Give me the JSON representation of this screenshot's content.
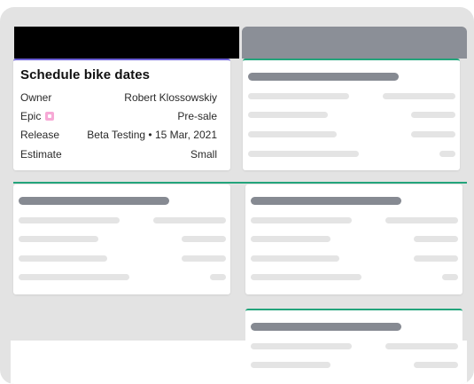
{
  "detail_card": {
    "title": "Schedule bike dates",
    "fields": [
      {
        "label": "Owner",
        "value": "Robert Klossowskiy"
      },
      {
        "label": "Epic",
        "value": "Pre-sale",
        "icon": "epic-badge-icon",
        "icon_color": "#f7a9d6"
      },
      {
        "label": "Release",
        "value": "Beta Testing • 15 Mar, 2021"
      },
      {
        "label": "Estimate",
        "value": "Small"
      }
    ]
  },
  "colors": {
    "active_card_border": "#6b5fd6",
    "card_border_green": "#23a47b",
    "skeleton_dark": "#868a92",
    "skeleton_light": "#e4e4e4",
    "board_background": "#e3e3e3",
    "column_header_gray": "#8b8f97",
    "column_header_black": "#000000"
  }
}
